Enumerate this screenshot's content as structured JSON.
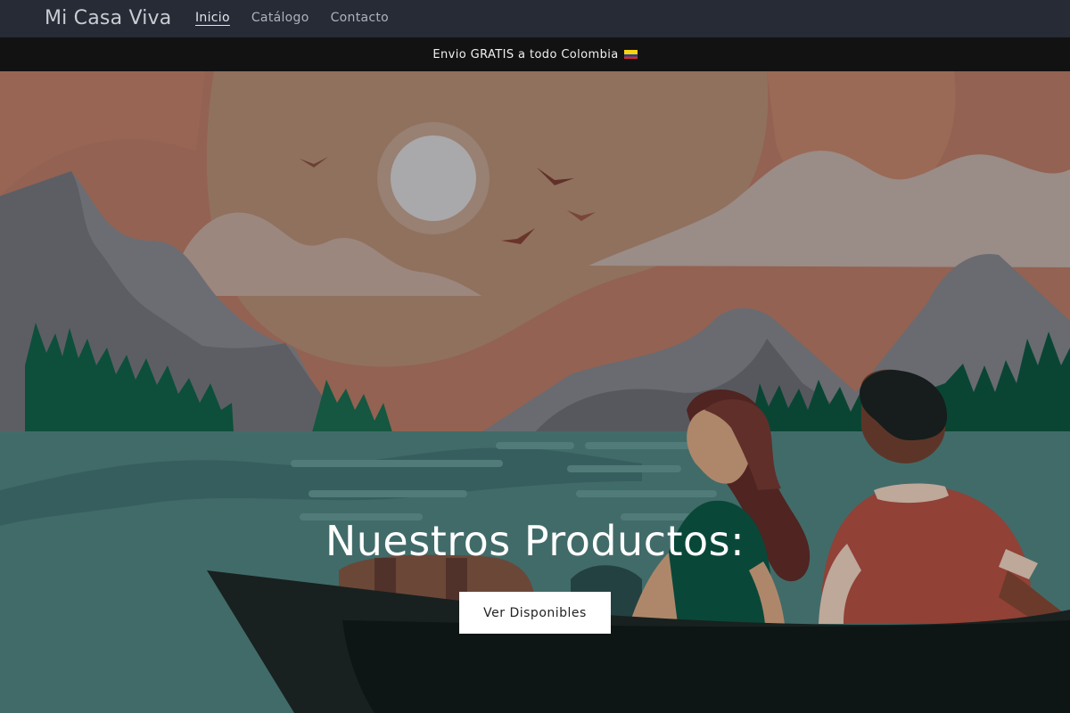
{
  "header": {
    "logo": "Mi Casa Viva",
    "nav": [
      {
        "label": "Inicio",
        "active": true
      },
      {
        "label": "Catálogo",
        "active": false
      },
      {
        "label": "Contacto",
        "active": false
      }
    ]
  },
  "announcement": {
    "text": "Envio GRATIS a todo Colombia",
    "icon": "colombia-flag-icon"
  },
  "hero": {
    "title": "Nuestros Productos:",
    "button_label": "Ver Disponibles",
    "colors": {
      "sky": "#a8826c",
      "water": "#4a7a78",
      "boat": "#1c2624",
      "trees": "#0f5a44"
    }
  }
}
